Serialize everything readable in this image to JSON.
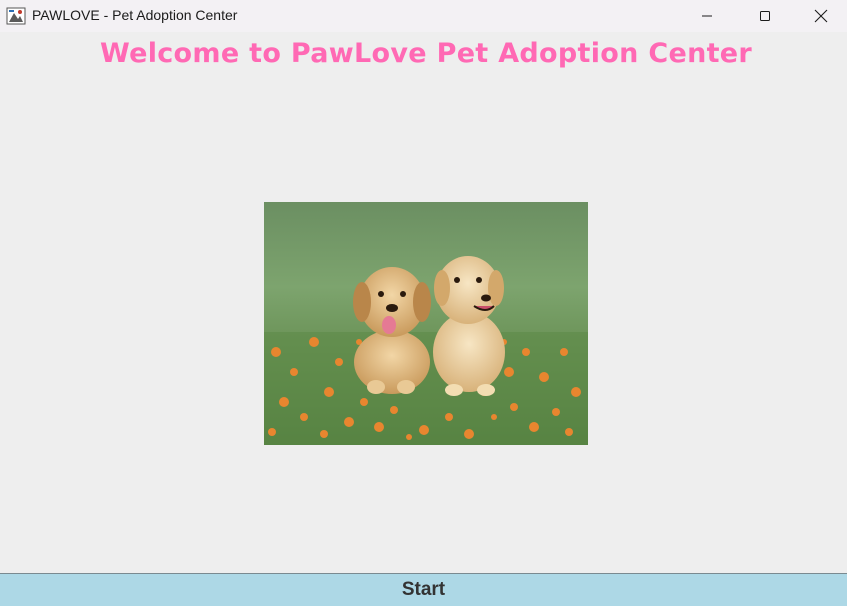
{
  "window": {
    "title": "PAWLOVE - Pet Adoption Center",
    "app_icon": "pawlove-app-icon",
    "controls": {
      "minimize_icon": "minimize-icon",
      "maximize_icon": "maximize-icon",
      "close_icon": "close-icon"
    }
  },
  "main": {
    "welcome_text": "Welcome to PawLove Pet Adoption Center",
    "welcome_color": "#ff69b4",
    "image": "two-golden-puppies-in-flower-field"
  },
  "footer": {
    "start_label": "Start",
    "start_bg_color": "#add8e6"
  }
}
